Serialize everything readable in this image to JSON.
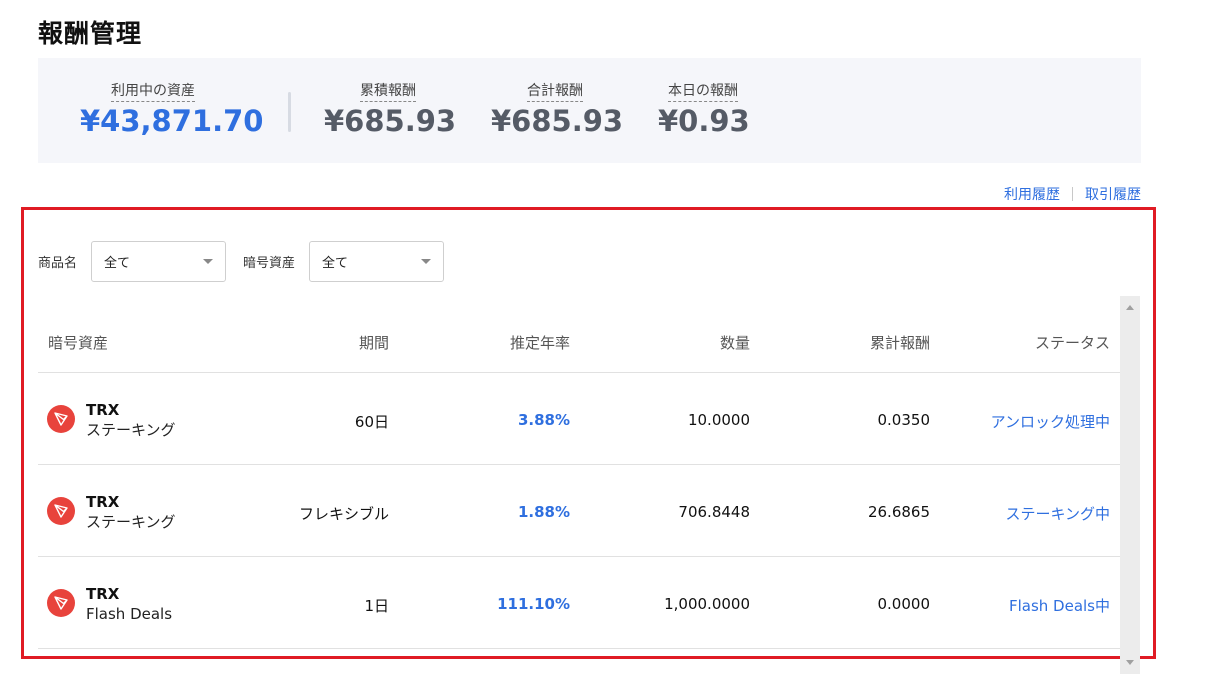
{
  "page": {
    "title": "報酬管理"
  },
  "summary": {
    "assets_in_use": {
      "label": "利用中の資産",
      "value": "¥43,871.70"
    },
    "cumulative_reward": {
      "label": "累積報酬",
      "value": "¥685.93"
    },
    "total_reward": {
      "label": "合計報酬",
      "value": "¥685.93"
    },
    "today_reward": {
      "label": "本日の報酬",
      "value": "¥0.93"
    }
  },
  "links": {
    "usage_history": "利用履歴",
    "transaction_history": "取引履歴"
  },
  "filters": {
    "product_label": "商品名",
    "product_value": "全て",
    "asset_label": "暗号資産",
    "asset_value": "全て"
  },
  "table": {
    "headers": [
      "暗号資産",
      "期間",
      "推定年率",
      "数量",
      "累計報酬",
      "ステータス"
    ],
    "rows": [
      {
        "symbol": "TRX",
        "product": "ステーキング",
        "period": "60日",
        "apr": "3.88%",
        "amount": "10.0000",
        "reward": "0.0350",
        "status": "アンロック処理中"
      },
      {
        "symbol": "TRX",
        "product": "ステーキング",
        "period": "フレキシブル",
        "apr": "1.88%",
        "amount": "706.8448",
        "reward": "26.6865",
        "status": "ステーキング中"
      },
      {
        "symbol": "TRX",
        "product": "Flash Deals",
        "period": "1日",
        "apr": "111.10%",
        "amount": "1,000.0000",
        "reward": "0.0000",
        "status": "Flash Deals中"
      }
    ]
  },
  "colors": {
    "accent": "#2f6fdf",
    "highlight": "#e01b24",
    "coin": "#e8433c"
  },
  "icons": {
    "coin": "tron-icon"
  }
}
